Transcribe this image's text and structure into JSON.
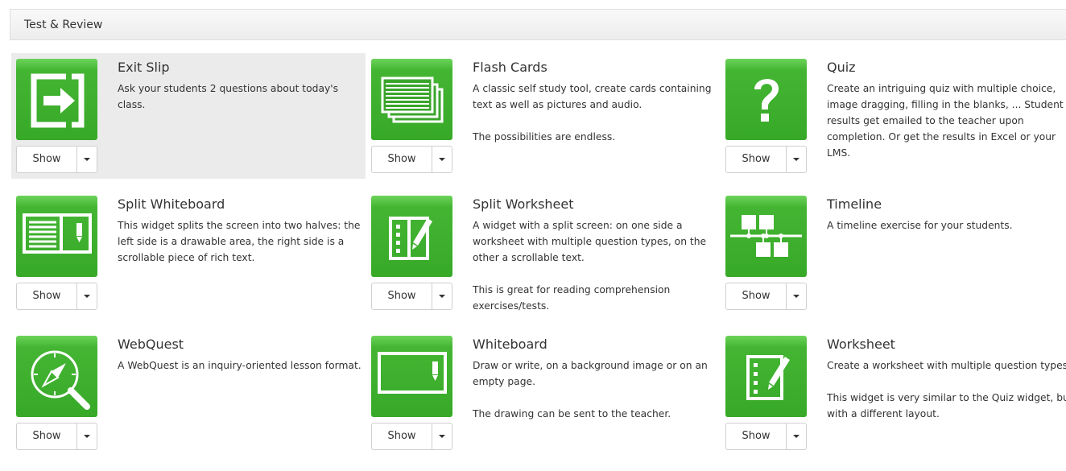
{
  "section": {
    "title": "Test & Review"
  },
  "widgets": [
    {
      "title": "Exit Slip",
      "icon": "exit-icon",
      "show_label": "Show",
      "desc": [
        "Ask your students 2 questions about today's class."
      ]
    },
    {
      "title": "Flash Cards",
      "icon": "flash-cards-icon",
      "show_label": "Show",
      "desc": [
        "A classic self study tool, create cards containing text as well as pictures and audio.",
        "The possibilities are endless."
      ]
    },
    {
      "title": "Quiz",
      "icon": "question-mark-icon",
      "show_label": "Show",
      "desc": [
        "Create an intriguing quiz with multiple choice, image dragging, filling in the blanks, ... Student results get emailed to the teacher upon completion. Or get the results in Excel or your LMS."
      ]
    },
    {
      "title": "Split Whiteboard",
      "icon": "split-whiteboard-icon",
      "show_label": "Show",
      "desc": [
        "This widget splits the screen into two halves: the left side is a drawable area, the right side is a scrollable piece of rich text."
      ]
    },
    {
      "title": "Split Worksheet",
      "icon": "split-worksheet-icon",
      "show_label": "Show",
      "desc": [
        "A widget with a split screen: on one side a worksheet with multiple question types, on the other a scrollable text.",
        "This is great for reading comprehension exercises/tests."
      ]
    },
    {
      "title": "Timeline",
      "icon": "timeline-icon",
      "show_label": "Show",
      "desc": [
        "A timeline exercise for your students."
      ]
    },
    {
      "title": "WebQuest",
      "icon": "compass-search-icon",
      "show_label": "Show",
      "desc": [
        "A WebQuest is an inquiry-oriented lesson format."
      ]
    },
    {
      "title": "Whiteboard",
      "icon": "whiteboard-icon",
      "show_label": "Show",
      "desc": [
        "Draw or write, on a background image or on an empty page.",
        "The drawing can be sent to the teacher."
      ]
    },
    {
      "title": "Worksheet",
      "icon": "worksheet-icon",
      "show_label": "Show",
      "desc": [
        "Create a worksheet with multiple question types.",
        "This widget is very similar to the Quiz widget, but with a different layout."
      ]
    }
  ]
}
